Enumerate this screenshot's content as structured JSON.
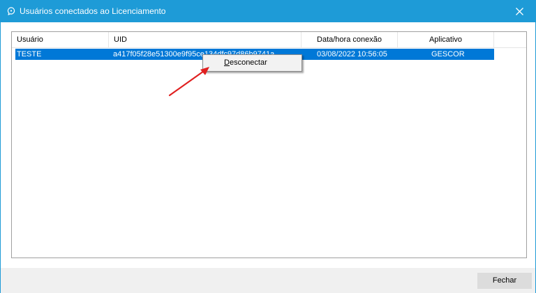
{
  "window": {
    "title": "Usuários conectados ao Licenciamento",
    "icon": "chat-bubble-icon",
    "close_icon": "close-icon",
    "accent_color": "#1e9bd7"
  },
  "table": {
    "columns": [
      "Usuário",
      "UID",
      "Data/hora conexão",
      "Aplicativo"
    ],
    "rows": [
      {
        "usuario": "TESTE",
        "uid": "a417f05f28e51300e9f95ce134dfc97d86b9741a",
        "data_hora": "03/08/2022 10:56:05",
        "aplicativo": "GESCOR",
        "selected": true
      }
    ],
    "selection_color": "#0078d7"
  },
  "context_menu": {
    "items": [
      "Desconectar"
    ]
  },
  "annotation": {
    "arrow_color": "#e02020"
  },
  "footer": {
    "close_label": "Fechar"
  }
}
